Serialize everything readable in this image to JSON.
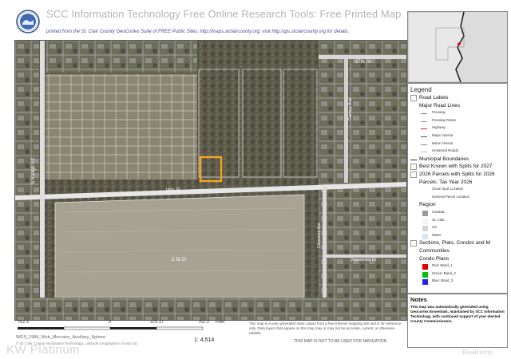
{
  "header": {
    "title": "SCC Information Technology Free Online Research Tools: Free Printed Map",
    "subtitle": "printed from the St. Clair County GeoCortex Suite of FREE Public Sites: http://maps.stclaircounty.org; visit http://gis.stclaircounty.org for details."
  },
  "map": {
    "labels": {
      "street_17th": "17th St",
      "street_18th": "18th St",
      "range_rd": "S Range Rd",
      "carney_ave": "Carney Ave",
      "cleveland_ave": "Cleveland Ave",
      "joanwood_dr": "Joanwood Dr",
      "parcel_id": "2 St Cl"
    },
    "colors": {
      "highlight_parcel": "#f5a623",
      "parcel_lines": "#ffffff",
      "road": "#e6e6e6"
    }
  },
  "legend": {
    "title": "Legend",
    "items": [
      {
        "kind": "check",
        "label": "Road Labels",
        "style": "head"
      },
      {
        "kind": "none",
        "label": "Major Road Lines",
        "style": "head"
      },
      {
        "kind": "line",
        "label": "Freeway",
        "color": "#777777"
      },
      {
        "kind": "line",
        "label": "Freeway Ramp",
        "color": "#999999"
      },
      {
        "kind": "line",
        "label": "Highway",
        "color": "#cc3333"
      },
      {
        "kind": "line",
        "label": "Major Arterial",
        "color": "#555577"
      },
      {
        "kind": "line",
        "label": "Minor Arterial",
        "color": "#888888"
      },
      {
        "kind": "line",
        "label": "Unnamed Roads",
        "color": "#bbbbbb"
      },
      {
        "kind": "line",
        "label": "Municipal Boundaries",
        "style": "head",
        "color": "#333333"
      },
      {
        "kind": "check",
        "label": "Best Known with Splits for 2027",
        "style": "head"
      },
      {
        "kind": "check",
        "label": "2026 Parcels with Splits for 2026",
        "style": "head"
      },
      {
        "kind": "none",
        "label": "Parcels: Tax Year 2026",
        "style": "head"
      },
      {
        "kind": "none",
        "label": "Close Spot Location",
        "style": "small"
      },
      {
        "kind": "none",
        "label": "General Parcel Location",
        "style": "small"
      },
      {
        "kind": "none",
        "label": "Region",
        "style": "head"
      },
      {
        "kind": "swatch",
        "label": "Canada",
        "color": "#9a9a9a"
      },
      {
        "kind": "swatch",
        "label": "St. Clair",
        "color": "#f4f4f4"
      },
      {
        "kind": "swatch",
        "label": "US",
        "color": "#d4d4d4"
      },
      {
        "kind": "swatch",
        "label": "Water",
        "color": "#cfe8f4"
      },
      {
        "kind": "check",
        "label": "Sections, Plats, Condos and M",
        "style": "head"
      },
      {
        "kind": "none",
        "label": "Communities",
        "style": "head"
      },
      {
        "kind": "none",
        "label": "Condo Plans",
        "style": "head"
      },
      {
        "kind": "swatch",
        "label": "Red: Band_1",
        "color": "#e00000"
      },
      {
        "kind": "swatch",
        "label": "Green: Band_2",
        "color": "#00c000"
      },
      {
        "kind": "swatch",
        "label": "Blue: Band_3",
        "color": "#2222ee"
      }
    ]
  },
  "notes": {
    "title": "Notes",
    "text": "This map was automatically generated using Geocortex Essentials, maintained by SCC Information Technology, with continued support of your elected County Commissioners."
  },
  "scale": {
    "ticks": [
      "752.3",
      "0",
      "376.17",
      "752.3"
    ],
    "unit": "Feet",
    "ratio": "1: 4,514"
  },
  "footer": {
    "projection": "WGS_1984_Web_Mercator_Auxiliary_Sphere",
    "credit": "© St. Clair County Information Technology, Lattitude Geographics Group Ltd.",
    "disclaimer": "This map is a user generated static output from a free Internet mapping site and is for reference only. Data layers that appear on this map may or may not be accurate, current, or otherwise reliable.",
    "not_for_navigation": "THIS MAP IS NOT TO BE USED FOR NAVIGATION"
  },
  "watermarks": {
    "left": "KW Platinum",
    "right": "Realcomp"
  }
}
